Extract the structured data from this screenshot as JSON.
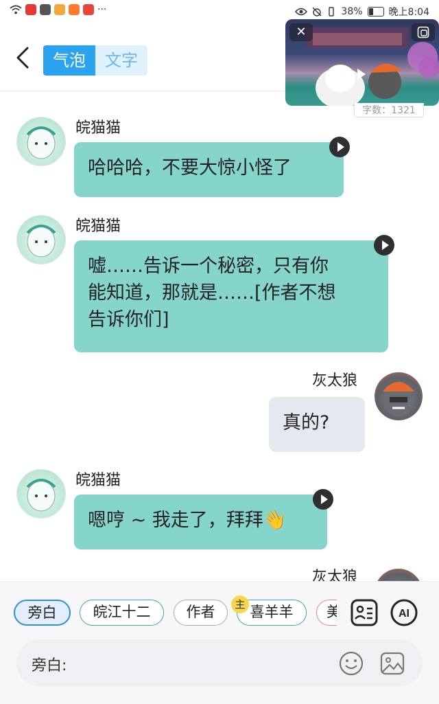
{
  "status_bar": {
    "battery": "38%",
    "time": "晚上8:04",
    "overflow": "···"
  },
  "header": {
    "mode_bubble": "气泡",
    "mode_text": "文字"
  },
  "video": {
    "wordcount": "字数：1321"
  },
  "messages": [
    {
      "sender": "皖猫猫",
      "text": "哈哈哈，不要大惊小怪了"
    },
    {
      "sender": "皖猫猫",
      "line1": "嘘……告诉一个秘密，只有你",
      "line2": "能知道，那就是……[作者不想",
      "line3": "告诉你们]"
    },
    {
      "sender": "灰太狼",
      "text": "真的?"
    },
    {
      "sender": "皖猫猫",
      "text": "嗯哼 ~ 我走了，拜拜👋"
    },
    {
      "sender": "灰太狼"
    }
  ],
  "roles": [
    {
      "label": "旁白"
    },
    {
      "label": "皖江十二"
    },
    {
      "label": "作者"
    },
    {
      "label": "喜羊羊",
      "badge": "主"
    },
    {
      "label": "美"
    }
  ],
  "input": {
    "label": "旁白:"
  }
}
